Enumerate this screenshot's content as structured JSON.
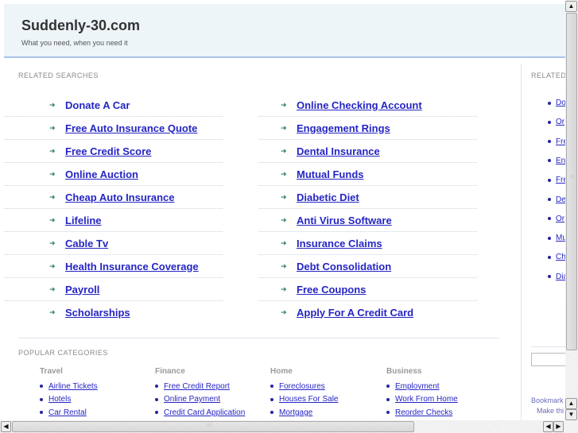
{
  "header": {
    "title": "Suddenly-30.com",
    "tagline": "What you need, when you need it"
  },
  "related_searches": {
    "label": "RELATED SEARCHES",
    "left": [
      {
        "label": "Donate A Car",
        "hovered": true
      },
      {
        "label": "Free Auto Insurance Quote"
      },
      {
        "label": "Free Credit Score"
      },
      {
        "label": "Online Auction"
      },
      {
        "label": "Cheap Auto Insurance"
      },
      {
        "label": "Lifeline"
      },
      {
        "label": "Cable Tv"
      },
      {
        "label": "Health Insurance Coverage"
      },
      {
        "label": "Payroll"
      },
      {
        "label": "Scholarships"
      }
    ],
    "right": [
      {
        "label": "Online Checking Account"
      },
      {
        "label": "Engagement Rings"
      },
      {
        "label": "Dental Insurance"
      },
      {
        "label": "Mutual Funds"
      },
      {
        "label": "Diabetic Diet"
      },
      {
        "label": "Anti Virus Software"
      },
      {
        "label": "Insurance Claims"
      },
      {
        "label": "Debt Consolidation"
      },
      {
        "label": "Free Coupons"
      },
      {
        "label": "Apply For A Credit Card"
      }
    ]
  },
  "popular_categories": {
    "label": "POPULAR CATEGORIES",
    "columns": [
      {
        "title": "Travel",
        "items": [
          "Airline Tickets",
          "Hotels",
          "Car Rental"
        ]
      },
      {
        "title": "Finance",
        "items": [
          "Free Credit Report",
          "Online Payment",
          "Credit Card Application"
        ]
      },
      {
        "title": "Home",
        "items": [
          "Foreclosures",
          "Houses For Sale",
          "Mortgage"
        ]
      },
      {
        "title": "Business",
        "items": [
          "Employment",
          "Work From Home",
          "Reorder Checks"
        ]
      }
    ]
  },
  "sidebar": {
    "label": "RELATED",
    "items": [
      "Do",
      "Or",
      "Fre",
      "En",
      "Fre",
      "De",
      "Or",
      "Mu",
      "Ch",
      "Dia"
    ],
    "search_input_value": "",
    "bookmark_label": "Bookmark",
    "make_this_label": "Make thi"
  },
  "icons": {
    "arrow": "➜",
    "scroll_up": "▲",
    "scroll_down": "▼",
    "scroll_left": "◀",
    "scroll_right": "▶"
  },
  "colors": {
    "link": "#2525c4",
    "arrow": "#2c7a6a",
    "header_bg": "#eef5f8",
    "header_border": "#a9c3e8"
  }
}
